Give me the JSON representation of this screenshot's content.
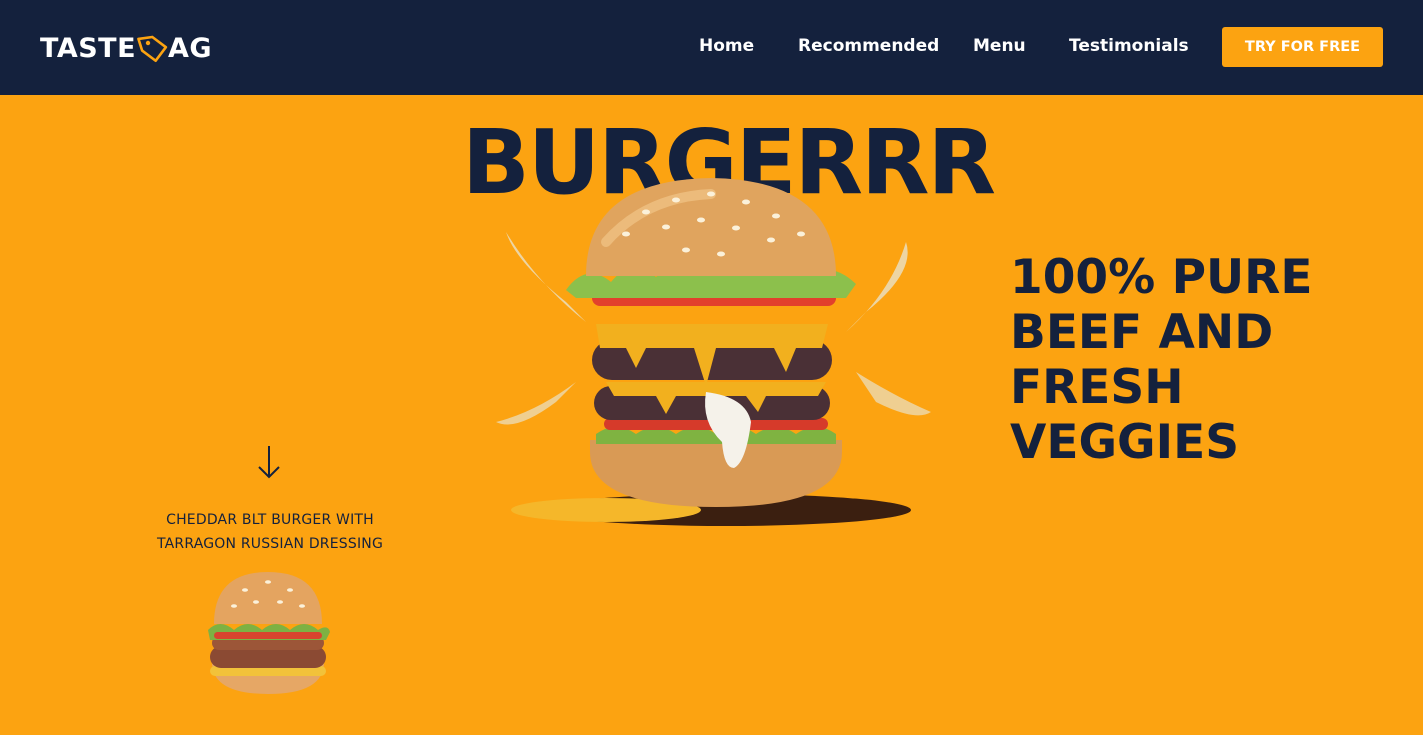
{
  "nav": {
    "logo_left": "TASTE",
    "logo_right": "AG",
    "links": [
      "Home",
      "Recommended",
      "Menu",
      "Testimonials"
    ],
    "cta_label": "TRY FOR FREE"
  },
  "hero": {
    "title": "BURGERRR",
    "tagline": "100% PURE BEEF AND FRESH VEGGIES"
  },
  "featured": {
    "caption_line1": "CHEDDAR BLT BURGER WITH",
    "caption_line2": "TARRAGON RUSSIAN DRESSING"
  },
  "icons": {
    "logo": "tag-icon",
    "scroll": "arrow-down-icon"
  },
  "colors": {
    "navy": "#14213d",
    "accent": "#fca311",
    "text_light": "#ffffff"
  }
}
